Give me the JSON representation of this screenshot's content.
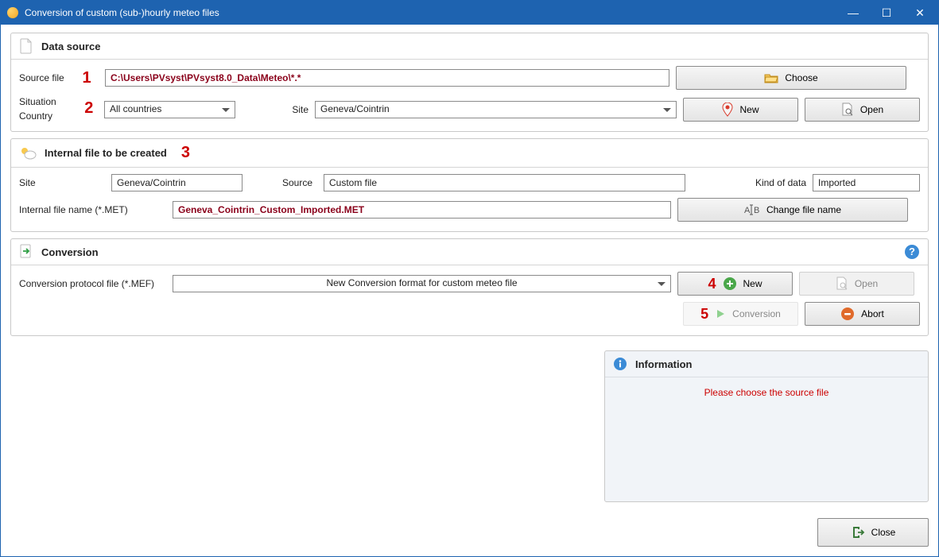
{
  "window": {
    "title": "Conversion of custom (sub-)hourly meteo files"
  },
  "dataSource": {
    "heading": "Data source",
    "sourceFileLabel": "Source file",
    "sourceFileValue": "C:\\Users\\PVsyst\\PVsyst8.0_Data\\Meteo\\*.*",
    "chooseLabel": "Choose",
    "situationLabel": "Situation",
    "countryLabel": "Country",
    "countryValue": "All countries",
    "siteLabel": "Site",
    "siteValue": "Geneva/Cointrin",
    "newLabel": "New",
    "openLabel": "Open",
    "step1": "1",
    "step2": "2"
  },
  "internalFile": {
    "heading": "Internal file to be created",
    "step3": "3",
    "siteLabel": "Site",
    "siteValue": "Geneva/Cointrin",
    "sourceLabel": "Source",
    "sourceValue": "Custom file",
    "kindOfDataLabel": "Kind of data",
    "kindValue": "Imported",
    "internalFileNameLabel": "Internal file name (*.MET)",
    "internalFileNameValue": "Geneva_Cointrin_Custom_Imported.MET",
    "changeFileNameLabel": "Change file name"
  },
  "conversion": {
    "heading": "Conversion",
    "protocolLabel": "Conversion protocol file (*.MEF)",
    "protocolValue": "New Conversion format for custom meteo file",
    "newLabel": "New",
    "openLabel": "Open",
    "conversionLabel": "Conversion",
    "abortLabel": "Abort",
    "step4": "4",
    "step5": "5"
  },
  "info": {
    "heading": "Information",
    "message": "Please choose the source file"
  },
  "footer": {
    "closeLabel": "Close"
  }
}
